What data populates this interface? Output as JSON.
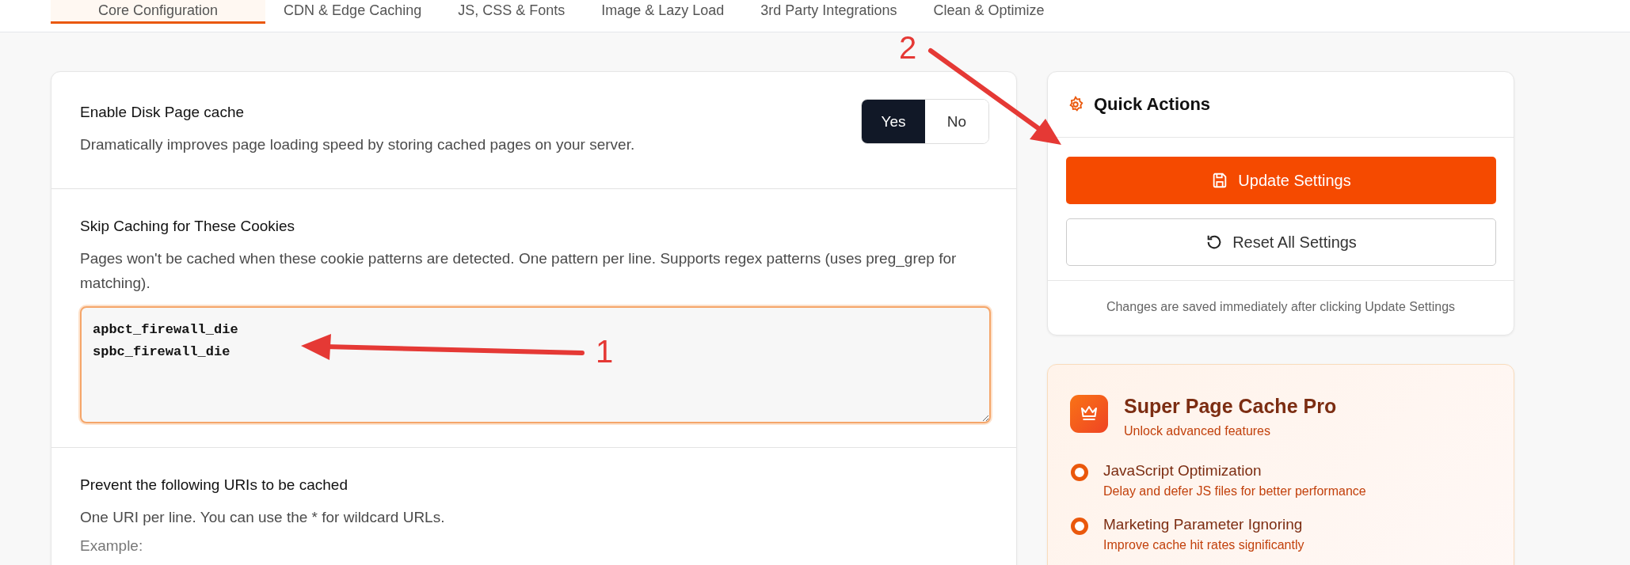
{
  "tabs": [
    {
      "label": "Core Configuration",
      "selected": true
    },
    {
      "label": "CDN & Edge Caching",
      "selected": false
    },
    {
      "label": "JS, CSS & Fonts",
      "selected": false
    },
    {
      "label": "Image & Lazy Load",
      "selected": false
    },
    {
      "label": "3rd Party Integrations",
      "selected": false
    },
    {
      "label": "Clean & Optimize",
      "selected": false
    }
  ],
  "settings": [
    {
      "kind": "toggle",
      "title": "Enable Disk Page cache",
      "description": "Dramatically improves page loading speed by storing cached pages on your server.",
      "options": [
        {
          "label": "Yes",
          "selected": true
        },
        {
          "label": "No",
          "selected": false
        }
      ]
    },
    {
      "kind": "textarea",
      "title": "Skip Caching for These Cookies",
      "description": "Pages won't be cached when these cookie patterns are detected. One pattern per line. Supports regex patterns (uses preg_grep for matching).",
      "value": "apbct_firewall_die \nspbc_firewall_die",
      "focused": true
    },
    {
      "kind": "textarea_cut",
      "title": "Prevent the following URIs to be cached",
      "description": "One URI per line. You can use the * for wildcard URLs.",
      "hint": "Example:"
    }
  ],
  "quick_actions": {
    "title": "Quick Actions",
    "primary_button": "Update Settings",
    "secondary_button": "Reset All Settings",
    "note": "Changes are saved immediately after clicking Update Settings"
  },
  "pro": {
    "title": "Super Page Cache Pro",
    "subtitle": "Unlock advanced features",
    "features": [
      {
        "title": "JavaScript Optimization",
        "description": "Delay and defer JS files for better performance"
      },
      {
        "title": "Marketing Parameter Ignoring",
        "description": "Improve cache hit rates significantly"
      }
    ]
  },
  "annotations": [
    {
      "label": "1"
    },
    {
      "label": "2"
    }
  ]
}
